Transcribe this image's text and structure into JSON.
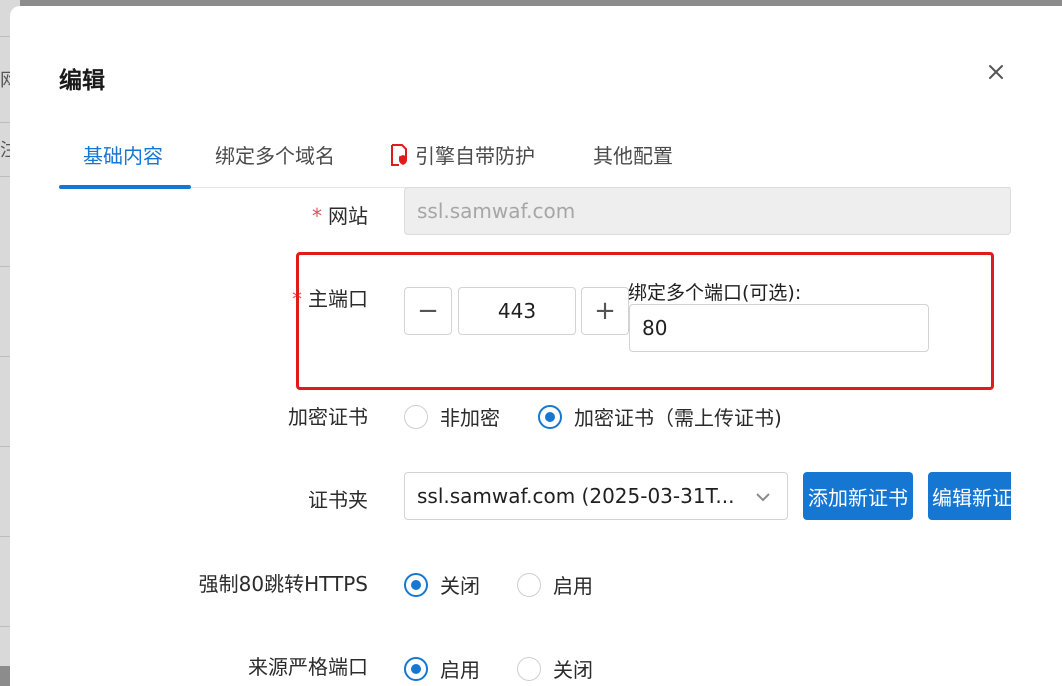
{
  "background": {
    "fragment_chars": [
      "网",
      "注"
    ]
  },
  "dialog": {
    "title": "编辑",
    "close_icon": "close-icon",
    "tabs": [
      {
        "label": "基础内容",
        "active": true
      },
      {
        "label": "绑定多个域名",
        "active": false
      },
      {
        "label": "引擎自带防护",
        "active": false,
        "icon": "shield-document-icon"
      },
      {
        "label": "其他配置",
        "active": false
      }
    ]
  },
  "form": {
    "required_mark": "*",
    "website": {
      "label": "网站",
      "value": "ssl.samwaf.com",
      "disabled": true
    },
    "main_port": {
      "label": "主端口",
      "value": "443",
      "decrement": "−",
      "increment": "+"
    },
    "extra_ports": {
      "label": "绑定多个端口(可选):",
      "value": "80"
    },
    "cert": {
      "label": "加密证书",
      "options": [
        {
          "label": "非加密",
          "checked": false
        },
        {
          "label": "加密证书（需上传证书)",
          "checked": true
        }
      ]
    },
    "cert_folder": {
      "label": "证书夹",
      "selected": "ssl.samwaf.com (2025-03-31T...",
      "add_button": "添加新证书",
      "edit_button": "编辑新证书"
    },
    "force_https": {
      "label": "强制80跳转HTTPS",
      "options": [
        {
          "label": "关闭",
          "checked": true
        },
        {
          "label": "启用",
          "checked": false
        }
      ]
    },
    "strict_port": {
      "label": "来源严格端口",
      "options": [
        {
          "label": "启用",
          "checked": true
        },
        {
          "label": "关闭",
          "checked": false
        }
      ]
    }
  },
  "colors": {
    "primary": "#1677d2",
    "highlight_border": "#e11b1b",
    "required": "#e34d59"
  }
}
